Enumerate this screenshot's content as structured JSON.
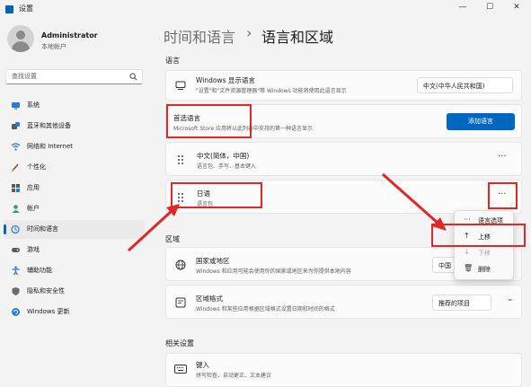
{
  "window": {
    "title": "设置",
    "minimize": "—",
    "maximize": "☐",
    "close": "✕"
  },
  "user": {
    "name": "Administrator",
    "account_type": "本地帐户"
  },
  "search": {
    "placeholder": "查找设置"
  },
  "sidebar": {
    "items": [
      {
        "label": "系统",
        "icon": "monitor-icon"
      },
      {
        "label": "蓝牙和其他设备",
        "icon": "bluetooth-icon"
      },
      {
        "label": "网络和 Internet",
        "icon": "wifi-icon"
      },
      {
        "label": "个性化",
        "icon": "brush-icon"
      },
      {
        "label": "应用",
        "icon": "apps-icon"
      },
      {
        "label": "帐户",
        "icon": "person-icon"
      },
      {
        "label": "时间和语言",
        "icon": "globe-clock-icon",
        "active": true
      },
      {
        "label": "游戏",
        "icon": "gamepad-icon"
      },
      {
        "label": "辅助功能",
        "icon": "accessibility-icon"
      },
      {
        "label": "隐私和安全性",
        "icon": "shield-icon"
      },
      {
        "label": "Windows 更新",
        "icon": "update-icon"
      }
    ]
  },
  "breadcrumb": {
    "parent": "时间和语言",
    "separator": "›",
    "current": "语言和区域"
  },
  "language_section": {
    "title": "语言",
    "display_language": {
      "title": "Windows 显示语言",
      "desc": "\"设置\"和\"文件资源管理器\"等 Windows 功能将使用此语言显示",
      "value": "中文(中华人民共和国)"
    },
    "preferred": {
      "title": "首选语言",
      "desc": "Microsoft Store 应用将以此列表中支持的第一种语言显示",
      "button": "添加语言"
    },
    "languages": [
      {
        "title": "中文(简体，中国)",
        "desc": "语言包、手写、基本键入",
        "more": "···"
      },
      {
        "title": "日语",
        "desc": "语言包",
        "more": "···"
      }
    ]
  },
  "context_menu": {
    "items": [
      {
        "label": "语言选项",
        "icon": "···",
        "enabled": true
      },
      {
        "label": "上移",
        "icon": "↑",
        "enabled": true
      },
      {
        "label": "下移",
        "icon": "↓",
        "enabled": false
      },
      {
        "label": "删除",
        "icon": "🗑",
        "enabled": true
      }
    ]
  },
  "region_section": {
    "title": "区域",
    "country": {
      "title": "国家或地区",
      "desc": "Windows 和应用可能会使用你的国家或地区来为你提供本地内容",
      "value": "中国"
    },
    "format": {
      "title": "区域格式",
      "desc": "Windows 和某些应用根据区域格式设置日期和时间的格式",
      "value": "推荐的项目",
      "expand": "⌄"
    }
  },
  "related_section": {
    "title": "相关设置",
    "typing": {
      "title": "键入",
      "desc": "拼写检查、自动更正、文本建议"
    }
  },
  "colors": {
    "accent": "#0067c0",
    "highlight_box": "#e32727",
    "arrow": "#e32727"
  }
}
